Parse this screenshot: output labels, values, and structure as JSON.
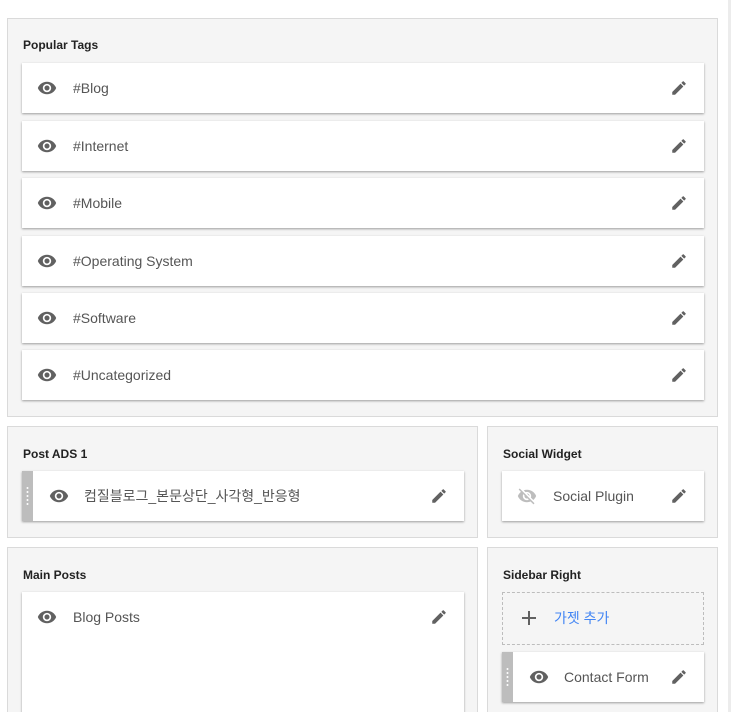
{
  "sections": {
    "popular_tags": {
      "title": "Popular Tags",
      "items": [
        {
          "label": "#Blog",
          "visible": true
        },
        {
          "label": "#Internet",
          "visible": true
        },
        {
          "label": "#Mobile",
          "visible": true
        },
        {
          "label": "#Operating System",
          "visible": true
        },
        {
          "label": "#Software",
          "visible": true
        },
        {
          "label": "#Uncategorized",
          "visible": true
        }
      ]
    },
    "post_ads_1": {
      "title": "Post ADS 1",
      "items": [
        {
          "label": "컴질블로그_본문상단_사각형_반응형",
          "visible": true
        }
      ]
    },
    "social_widget": {
      "title": "Social Widget",
      "items": [
        {
          "label": "Social Plugin",
          "visible": false
        }
      ]
    },
    "main_posts": {
      "title": "Main Posts",
      "items": [
        {
          "label": "Blog Posts",
          "visible": true
        }
      ]
    },
    "sidebar_right": {
      "title": "Sidebar Right",
      "add_gadget_label": "가젯 추가",
      "items": [
        {
          "label": "Contact Form",
          "visible": true
        }
      ]
    }
  },
  "icons": {
    "visible": "eye-icon",
    "hidden": "eye-off-icon",
    "edit": "pencil-icon",
    "add": "plus-icon",
    "drag": "drag-handle-icon"
  },
  "colors": {
    "section_bg": "#f5f5f5",
    "section_border": "#dadada",
    "icon": "#616161",
    "icon_muted": "#bdbdbd",
    "link": "#4285f4",
    "drag_handle": "#bdbdbd"
  }
}
